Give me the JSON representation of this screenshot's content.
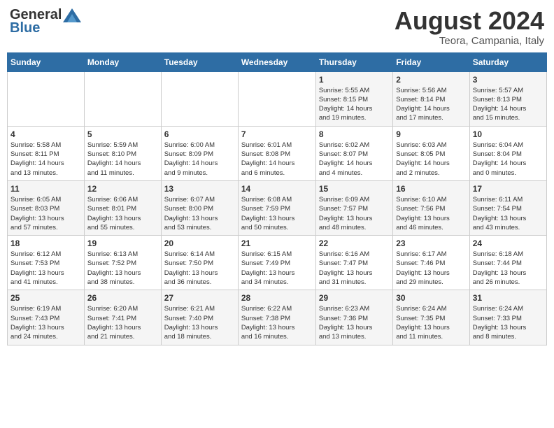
{
  "header": {
    "logo_general": "General",
    "logo_blue": "Blue",
    "month_title": "August 2024",
    "location": "Teora, Campania, Italy"
  },
  "days_of_week": [
    "Sunday",
    "Monday",
    "Tuesday",
    "Wednesday",
    "Thursday",
    "Friday",
    "Saturday"
  ],
  "weeks": [
    [
      {
        "day": "",
        "info": ""
      },
      {
        "day": "",
        "info": ""
      },
      {
        "day": "",
        "info": ""
      },
      {
        "day": "",
        "info": ""
      },
      {
        "day": "1",
        "info": "Sunrise: 5:55 AM\nSunset: 8:15 PM\nDaylight: 14 hours\nand 19 minutes."
      },
      {
        "day": "2",
        "info": "Sunrise: 5:56 AM\nSunset: 8:14 PM\nDaylight: 14 hours\nand 17 minutes."
      },
      {
        "day": "3",
        "info": "Sunrise: 5:57 AM\nSunset: 8:13 PM\nDaylight: 14 hours\nand 15 minutes."
      }
    ],
    [
      {
        "day": "4",
        "info": "Sunrise: 5:58 AM\nSunset: 8:11 PM\nDaylight: 14 hours\nand 13 minutes."
      },
      {
        "day": "5",
        "info": "Sunrise: 5:59 AM\nSunset: 8:10 PM\nDaylight: 14 hours\nand 11 minutes."
      },
      {
        "day": "6",
        "info": "Sunrise: 6:00 AM\nSunset: 8:09 PM\nDaylight: 14 hours\nand 9 minutes."
      },
      {
        "day": "7",
        "info": "Sunrise: 6:01 AM\nSunset: 8:08 PM\nDaylight: 14 hours\nand 6 minutes."
      },
      {
        "day": "8",
        "info": "Sunrise: 6:02 AM\nSunset: 8:07 PM\nDaylight: 14 hours\nand 4 minutes."
      },
      {
        "day": "9",
        "info": "Sunrise: 6:03 AM\nSunset: 8:05 PM\nDaylight: 14 hours\nand 2 minutes."
      },
      {
        "day": "10",
        "info": "Sunrise: 6:04 AM\nSunset: 8:04 PM\nDaylight: 14 hours\nand 0 minutes."
      }
    ],
    [
      {
        "day": "11",
        "info": "Sunrise: 6:05 AM\nSunset: 8:03 PM\nDaylight: 13 hours\nand 57 minutes."
      },
      {
        "day": "12",
        "info": "Sunrise: 6:06 AM\nSunset: 8:01 PM\nDaylight: 13 hours\nand 55 minutes."
      },
      {
        "day": "13",
        "info": "Sunrise: 6:07 AM\nSunset: 8:00 PM\nDaylight: 13 hours\nand 53 minutes."
      },
      {
        "day": "14",
        "info": "Sunrise: 6:08 AM\nSunset: 7:59 PM\nDaylight: 13 hours\nand 50 minutes."
      },
      {
        "day": "15",
        "info": "Sunrise: 6:09 AM\nSunset: 7:57 PM\nDaylight: 13 hours\nand 48 minutes."
      },
      {
        "day": "16",
        "info": "Sunrise: 6:10 AM\nSunset: 7:56 PM\nDaylight: 13 hours\nand 46 minutes."
      },
      {
        "day": "17",
        "info": "Sunrise: 6:11 AM\nSunset: 7:54 PM\nDaylight: 13 hours\nand 43 minutes."
      }
    ],
    [
      {
        "day": "18",
        "info": "Sunrise: 6:12 AM\nSunset: 7:53 PM\nDaylight: 13 hours\nand 41 minutes."
      },
      {
        "day": "19",
        "info": "Sunrise: 6:13 AM\nSunset: 7:52 PM\nDaylight: 13 hours\nand 38 minutes."
      },
      {
        "day": "20",
        "info": "Sunrise: 6:14 AM\nSunset: 7:50 PM\nDaylight: 13 hours\nand 36 minutes."
      },
      {
        "day": "21",
        "info": "Sunrise: 6:15 AM\nSunset: 7:49 PM\nDaylight: 13 hours\nand 34 minutes."
      },
      {
        "day": "22",
        "info": "Sunrise: 6:16 AM\nSunset: 7:47 PM\nDaylight: 13 hours\nand 31 minutes."
      },
      {
        "day": "23",
        "info": "Sunrise: 6:17 AM\nSunset: 7:46 PM\nDaylight: 13 hours\nand 29 minutes."
      },
      {
        "day": "24",
        "info": "Sunrise: 6:18 AM\nSunset: 7:44 PM\nDaylight: 13 hours\nand 26 minutes."
      }
    ],
    [
      {
        "day": "25",
        "info": "Sunrise: 6:19 AM\nSunset: 7:43 PM\nDaylight: 13 hours\nand 24 minutes."
      },
      {
        "day": "26",
        "info": "Sunrise: 6:20 AM\nSunset: 7:41 PM\nDaylight: 13 hours\nand 21 minutes."
      },
      {
        "day": "27",
        "info": "Sunrise: 6:21 AM\nSunset: 7:40 PM\nDaylight: 13 hours\nand 18 minutes."
      },
      {
        "day": "28",
        "info": "Sunrise: 6:22 AM\nSunset: 7:38 PM\nDaylight: 13 hours\nand 16 minutes."
      },
      {
        "day": "29",
        "info": "Sunrise: 6:23 AM\nSunset: 7:36 PM\nDaylight: 13 hours\nand 13 minutes."
      },
      {
        "day": "30",
        "info": "Sunrise: 6:24 AM\nSunset: 7:35 PM\nDaylight: 13 hours\nand 11 minutes."
      },
      {
        "day": "31",
        "info": "Sunrise: 6:24 AM\nSunset: 7:33 PM\nDaylight: 13 hours\nand 8 minutes."
      }
    ]
  ]
}
